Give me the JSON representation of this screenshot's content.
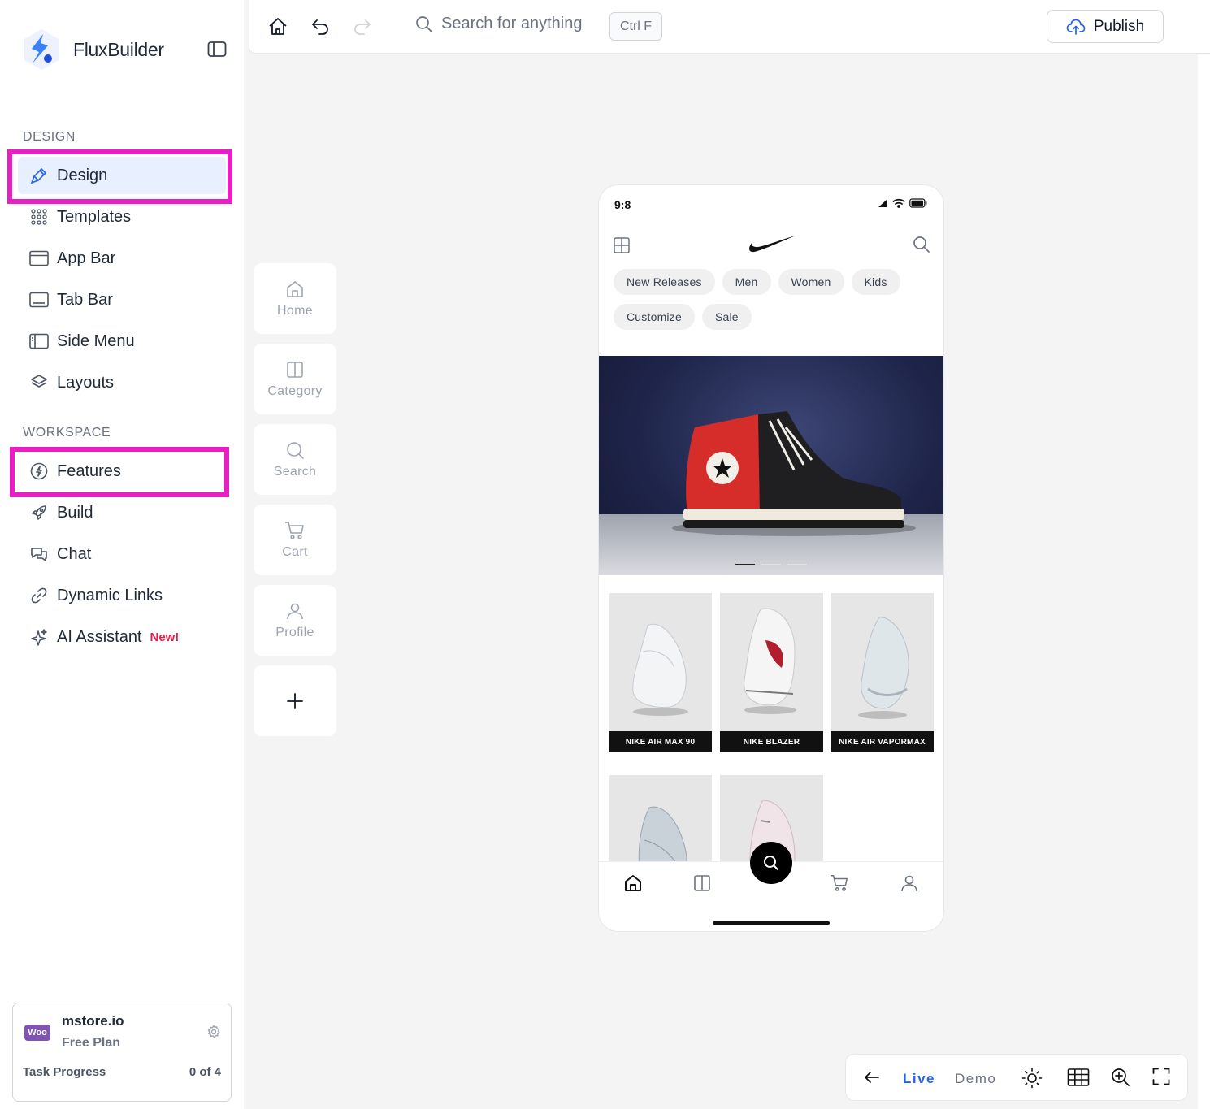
{
  "brand": {
    "name": "FluxBuilder"
  },
  "sidebar": {
    "design_label": "DESIGN",
    "workspace_label": "WORKSPACE",
    "design_items": [
      {
        "label": "Design",
        "icon": "brush-icon"
      },
      {
        "label": "Templates",
        "icon": "grid-dots-icon"
      },
      {
        "label": "App Bar",
        "icon": "app-bar-icon"
      },
      {
        "label": "Tab Bar",
        "icon": "tab-bar-icon"
      },
      {
        "label": "Side Menu",
        "icon": "side-menu-icon"
      },
      {
        "label": "Layouts",
        "icon": "layers-icon"
      }
    ],
    "workspace_items": [
      {
        "label": "Features",
        "icon": "bolt-icon"
      },
      {
        "label": "Build",
        "icon": "rocket-icon"
      },
      {
        "label": "Chat",
        "icon": "chat-icon"
      },
      {
        "label": "Dynamic Links",
        "icon": "link-icon"
      },
      {
        "label": "AI Assistant",
        "icon": "sparkle-icon",
        "badge": "New!"
      }
    ],
    "store": {
      "name": "mstore.io",
      "plan": "Free Plan",
      "woo": "Woo",
      "task_label": "Task Progress",
      "task_count": "0 of 4"
    }
  },
  "topbar": {
    "search_placeholder": "Search for anything",
    "shortcut": "Ctrl F",
    "publish_label": "Publish"
  },
  "screens": [
    {
      "label": "Home",
      "icon": "home-icon"
    },
    {
      "label": "Category",
      "icon": "columns-icon"
    },
    {
      "label": "Search",
      "icon": "search-icon"
    },
    {
      "label": "Cart",
      "icon": "cart-icon"
    },
    {
      "label": "Profile",
      "icon": "user-icon"
    }
  ],
  "phone": {
    "time": "9:8",
    "chips": [
      "New Releases",
      "Men",
      "Women",
      "Kids",
      "Customize",
      "Sale"
    ],
    "products": [
      "NIKE AIR MAX 90",
      "NIKE BLAZER",
      "NIKE AIR VAPORMAX",
      "",
      ""
    ],
    "banner_slide": 1,
    "banner_slides": 3
  },
  "bottom_tools": {
    "live": "Live",
    "demo": "Demo"
  },
  "colors": {
    "accent": "#2563eb",
    "highlight": "#e91ec4",
    "active_bg": "#e8efff",
    "badge": "#e11d48"
  }
}
